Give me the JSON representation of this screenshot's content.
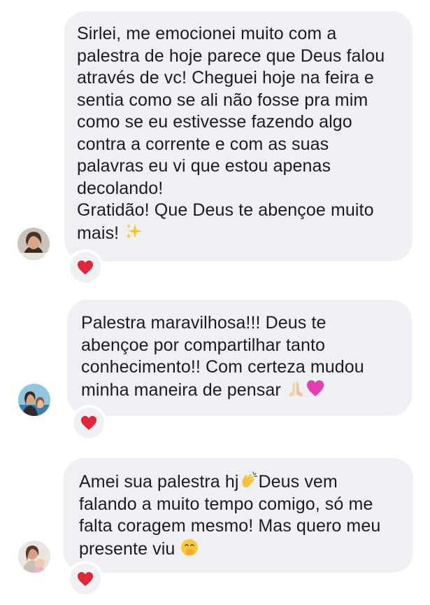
{
  "messages": [
    {
      "avatar_icon": "profile-photo-woman-1",
      "text_main": "Sirlei, me emocionei muito com a\npalestra de hoje parece que Deus falou\natravés de vc! Cheguei hoje na feira e\nsentia como se ali não fosse pra mim\ncomo se eu estivesse fazendo algo\ncontra a corrente e com as suas\npalavras eu vi que estou apenas\ndecolando!",
      "text_second": "Gratidão! Que Deus te abençoe muito\nmais!",
      "emoji": "sparkles",
      "reaction": "red-heart"
    },
    {
      "avatar_icon": "profile-photo-woman-child",
      "text": "Palestra maravilhosa!!! Deus te\nabençoe por compartilhar tanto\nconhecimento!! Com certeza mudou\nminha maneira de pensar",
      "emojis": [
        "folded-hands",
        "pink-heart"
      ],
      "reaction": "red-heart"
    },
    {
      "avatar_icon": "profile-photo-woman-baby",
      "text_before": "Amei sua palestra hj",
      "emoji_inline": "clapping-hands",
      "text_after": "Deus vem\nfalando a muito tempo comigo, só me\nfalta coragem mesmo! Mas quero meu\npresente viu",
      "emoji_end": "face-with-hand-over-mouth",
      "reaction": "red-heart"
    }
  ],
  "colors": {
    "bubble": "#eff0f4",
    "text": "#1c1c1e",
    "heart": "#e0263a"
  }
}
